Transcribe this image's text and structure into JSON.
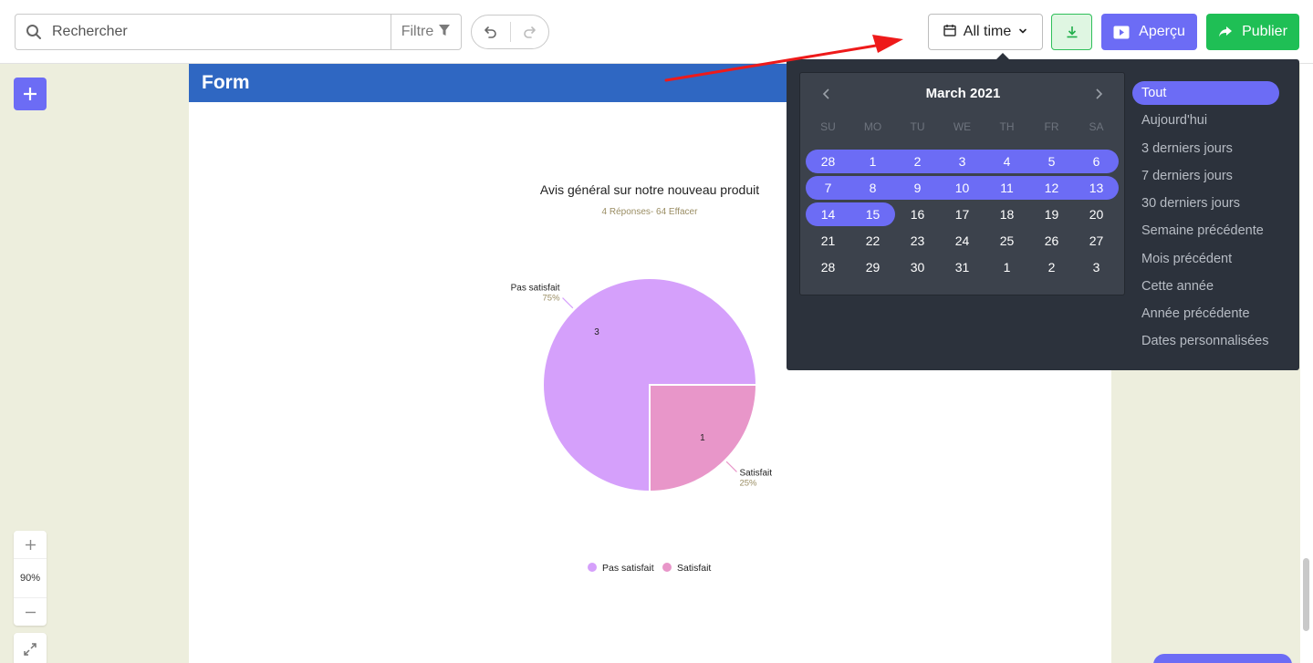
{
  "toolbar": {
    "search_placeholder": "Rechercher",
    "filter_label": "Filtre",
    "daterange_label": "All time",
    "preview_label": "Aperçu",
    "publish_label": "Publier"
  },
  "zoom": {
    "level": "90%"
  },
  "form": {
    "header": "Form"
  },
  "chart": {
    "title": "Avis général sur notre nouveau produit",
    "subtitle": "4 Réponses- 64 Effacer"
  },
  "chart_data": {
    "type": "pie",
    "title": "Avis général sur notre nouveau produit",
    "subtitle": "4 Réponses- 64 Effacer",
    "categories": [
      "Pas satisfait",
      "Satisfait"
    ],
    "values": [
      3,
      1
    ],
    "percents": [
      "75%",
      "25%"
    ],
    "colors": [
      "#d5a0fb",
      "#e896c9"
    ],
    "legend_position": "bottom"
  },
  "calendar": {
    "month_title": "March 2021",
    "weekdays": [
      "SU",
      "MO",
      "TU",
      "WE",
      "TH",
      "FR",
      "SA"
    ],
    "weeks": [
      [
        "28",
        "1",
        "2",
        "3",
        "4",
        "5",
        "6"
      ],
      [
        "7",
        "8",
        "9",
        "10",
        "11",
        "12",
        "13"
      ],
      [
        "14",
        "15",
        "16",
        "17",
        "18",
        "19",
        "20"
      ],
      [
        "21",
        "22",
        "23",
        "24",
        "25",
        "26",
        "27"
      ],
      [
        "28",
        "29",
        "30",
        "31",
        "1",
        "2",
        "3"
      ]
    ]
  },
  "presets": [
    "Tout",
    "Aujourd'hui",
    "3 derniers jours",
    "7 derniers jours",
    "30 derniers jours",
    "Semaine précédente",
    "Mois précédent",
    "Cette année",
    "Année précédente",
    "Dates personnalisées"
  ],
  "active_preset": "Tout",
  "accent_color": "#6c6cf5",
  "publish_color": "#1fbf55"
}
